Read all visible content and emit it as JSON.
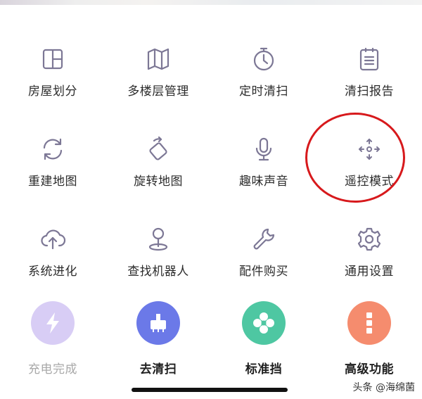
{
  "menu": {
    "rows": [
      [
        {
          "label": "房屋划分",
          "icon": "room-division-icon"
        },
        {
          "label": "多楼层管理",
          "icon": "map-icon"
        },
        {
          "label": "定时清扫",
          "icon": "timer-icon"
        },
        {
          "label": "清扫报告",
          "icon": "report-icon"
        }
      ],
      [
        {
          "label": "重建地图",
          "icon": "refresh-icon"
        },
        {
          "label": "旋转地图",
          "icon": "rotate-icon"
        },
        {
          "label": "趣味声音",
          "icon": "microphone-icon"
        },
        {
          "label": "遥控模式",
          "icon": "remote-control-icon"
        }
      ],
      [
        {
          "label": "系统进化",
          "icon": "cloud-upload-icon"
        },
        {
          "label": "查找机器人",
          "icon": "location-pin-icon"
        },
        {
          "label": "配件购买",
          "icon": "wrench-icon"
        },
        {
          "label": "通用设置",
          "icon": "settings-gear-icon"
        }
      ]
    ],
    "actions": [
      {
        "label": "充电完成",
        "icon": "lightning-icon",
        "color": "#d8cdf5"
      },
      {
        "label": "去清扫",
        "icon": "vacuum-brush-icon",
        "color": "#6b79e8"
      },
      {
        "label": "标准挡",
        "icon": "fan-icon",
        "color": "#4ec7a2"
      },
      {
        "label": "高级功能",
        "icon": "more-vertical-icon",
        "color": "#f58c6e"
      }
    ]
  },
  "colors": {
    "icon_stroke": "#7c7795",
    "highlight": "#d7191c"
  },
  "watermark": "头条 @海绵菌"
}
